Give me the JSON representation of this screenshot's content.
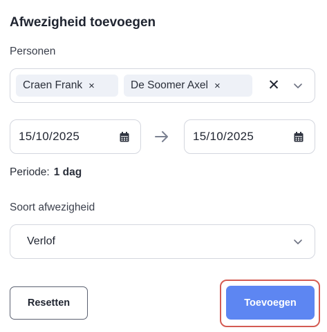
{
  "form": {
    "title": "Afwezigheid toevoegen",
    "persons_label": "Personen",
    "persons": [
      {
        "name": "Craen Frank",
        "remove": "×"
      },
      {
        "name": "De Soomer Axel",
        "remove": "×"
      }
    ],
    "clear_all": "✕",
    "date_from": "15/10/2025",
    "date_to": "15/10/2025",
    "periode_label": "Periode:",
    "periode_value": "1 dag",
    "type_label": "Soort afwezigheid",
    "type_value": "Verlof",
    "reset_label": "Resetten",
    "submit_label": "Toevoegen"
  },
  "icons": {
    "chevron": "chevron-down-icon",
    "calendar": "calendar-icon",
    "arrow": "arrow-right-icon"
  },
  "colors": {
    "primary": "#5d86f2",
    "highlight": "#d45b52",
    "chip_bg": "#eef1f7",
    "border": "#d3d6de"
  }
}
